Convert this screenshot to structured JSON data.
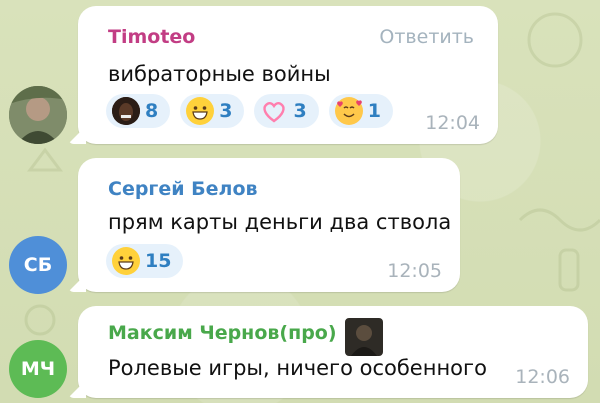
{
  "colors": {
    "chat_background": "#d6dfb8",
    "author_timoteo": "#c23d84",
    "author_sergey": "#3f83c3",
    "author_maksim": "#49a84b",
    "reaction_bg": "#e6f1fb",
    "reaction_text": "#2f7fc1",
    "avatar_sb": "#4f8fd8",
    "avatar_mch": "#5dbb55"
  },
  "messages": [
    {
      "author": "Timoteo",
      "reply_label": "Ответить",
      "text": "вибраторные войны",
      "time": "12:04",
      "reactions": [
        {
          "icon": "custom-photo-reaction",
          "count": "8"
        },
        {
          "icon": "grinning-face-emoji",
          "count": "3"
        },
        {
          "icon": "heart-emoji",
          "count": "3"
        },
        {
          "icon": "smiling-face-with-hearts-emoji",
          "count": "1"
        }
      ]
    },
    {
      "author": "Сергей Белов",
      "avatar_initials": "СБ",
      "text": "прям карты деньги два ствола",
      "time": "12:05",
      "reactions": [
        {
          "icon": "grinning-face-emoji",
          "count": "15"
        }
      ]
    },
    {
      "author": "Максим Чернов(про)",
      "avatar_initials": "МЧ",
      "text": "Ролевые игры, ничего особенного",
      "time": "12:06"
    }
  ]
}
